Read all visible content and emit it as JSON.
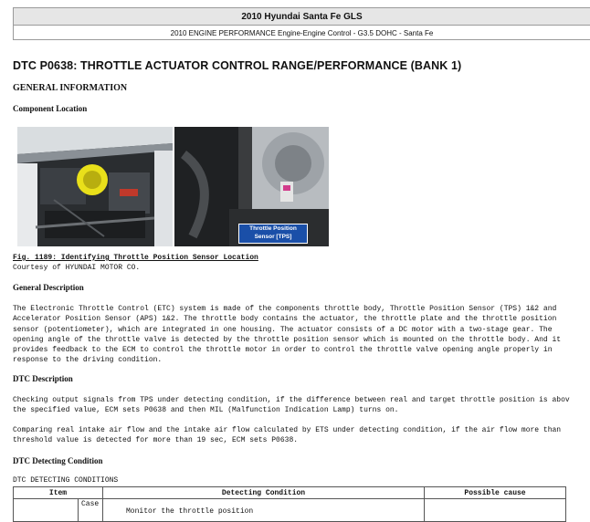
{
  "header": {
    "vehicle": "2010 Hyundai Santa Fe GLS",
    "subtitle": "2010 ENGINE PERFORMANCE Engine-Engine Control - G3.5 DOHC - Santa Fe"
  },
  "title": "DTC P0638: THROTTLE ACTUATOR CONTROL RANGE/PERFORMANCE (BANK 1)",
  "general_information": "GENERAL INFORMATION",
  "component_location": "Component Location",
  "figure": {
    "label_line1": "Throttle Position",
    "label_line2": "Sensor [TPS]",
    "caption": "Fig. 1189: Identifying Throttle Position Sensor Location",
    "courtesy": "Courtesy of HYUNDAI MOTOR CO."
  },
  "general_description": {
    "heading": "General Description",
    "text": "The Electronic Throttle Control (ETC) system is made of the components throttle body, Throttle Position Sensor (TPS) 1&2 and\nAccelerator Position Sensor (APS) 1&2. The throttle body contains the actuator, the throttle plate and the throttle position\nsensor (potentiometer), which are integrated in one housing. The actuator consists of a DC motor with a two-stage gear. The\nopening angle of the throttle valve is detected by the throttle position sensor which is mounted on the throttle body. And it\nprovides feedback to the ECM to control the throttle motor in order to control the throttle valve opening angle properly in\nresponse to the driving condition."
  },
  "dtc_description": {
    "heading": "DTC Description",
    "text1": "Checking output signals from TPS under detecting condition, if the difference between real and target throttle position is abov\nthe specified value, ECM sets P0638 and then MIL (Malfunction Indication Lamp) turns on.",
    "text2": "Comparing real intake air flow and the intake air flow calculated by ETS under detecting condition, if the air flow more than\nthreshold value is detected for more than 19 sec, ECM sets P0638."
  },
  "dtc_detecting": {
    "heading": "DTC Detecting Condition",
    "label": "DTC DETECTING CONDITIONS",
    "columns": [
      "Item",
      "Detecting Condition",
      "Possible cause"
    ],
    "row1": {
      "item_sub": "Case",
      "condition": "Monitor the throttle position"
    }
  }
}
